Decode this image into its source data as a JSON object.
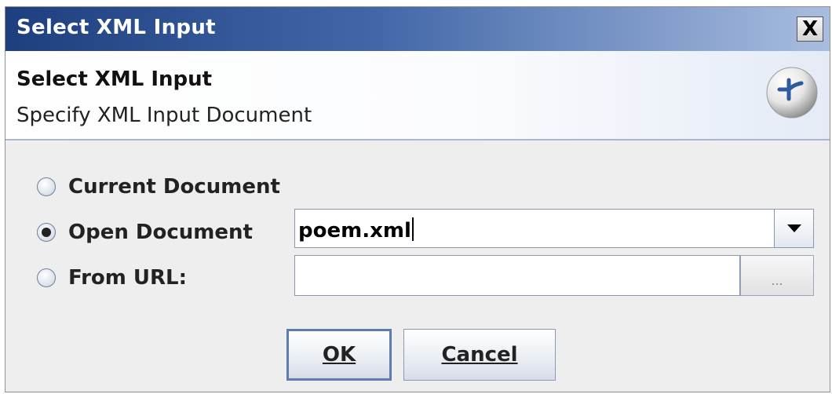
{
  "window": {
    "title": "Select XML Input",
    "close_label": "X"
  },
  "header": {
    "title": "Select XML Input",
    "subtitle": "Specify XML Input Document",
    "logo_icon": "altova-logo-icon"
  },
  "options": [
    {
      "label": "Current Document",
      "selected": false
    },
    {
      "label": "Open Document",
      "selected": true
    },
    {
      "label": "From URL:",
      "selected": false
    }
  ],
  "open_document": {
    "value": "poem.xml"
  },
  "from_url": {
    "value": "",
    "browse_label": "..."
  },
  "buttons": {
    "ok_label": "OK",
    "cancel_label": "Cancel"
  },
  "colors": {
    "titlebar_dark": "#1e3f7e",
    "titlebar_light": "#a8bde0",
    "dialog_bg": "#eeeeee",
    "ok_border": "#5f7cb0"
  }
}
